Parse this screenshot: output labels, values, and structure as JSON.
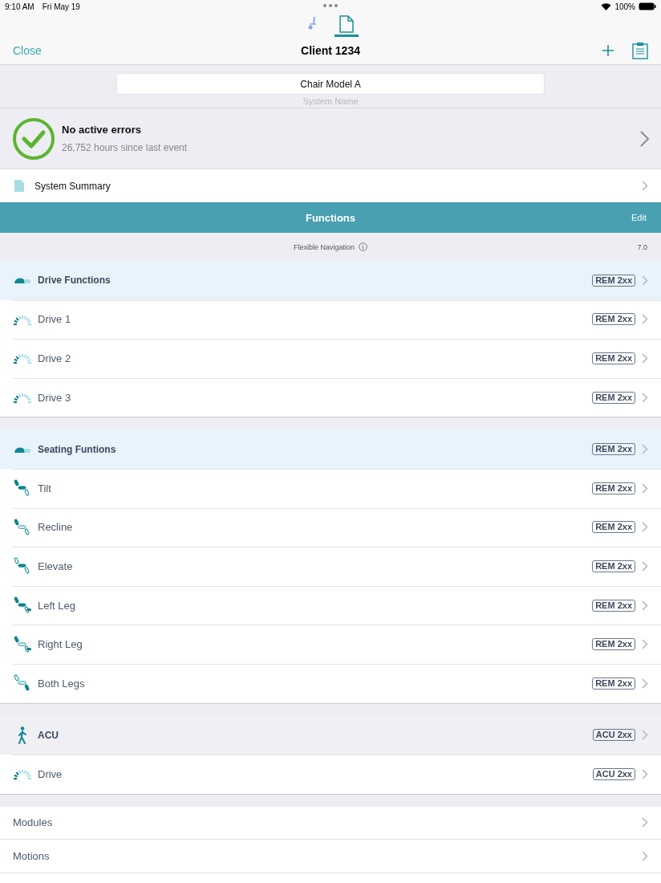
{
  "status_bar": {
    "time": "9:10 AM",
    "date": "Fri May 19",
    "battery": "100%"
  },
  "tabs": [
    {
      "kind": "chair",
      "selected": false
    },
    {
      "kind": "document",
      "selected": true
    }
  ],
  "nav": {
    "close": "Close",
    "title": "Client 1234"
  },
  "system": {
    "value": "Chair Model A",
    "placeholder": "System Name"
  },
  "errors": {
    "title": "No active errors",
    "subtitle": "26,752 hours since last event"
  },
  "summary": {
    "label": "System Summary"
  },
  "functions_bar": {
    "title": "Functions",
    "edit": "Edit"
  },
  "flexible_navigation": {
    "label": "Flexible Navigation",
    "version": "7.0"
  },
  "groups": [
    {
      "label": "Drive Functions",
      "badge": "REM 2xx",
      "kind": "toggle",
      "items": [
        {
          "label": "Drive 1",
          "badge": "REM 2xx",
          "kind": "gauge"
        },
        {
          "label": "Drive 2",
          "badge": "REM 2xx",
          "kind": "gauge"
        },
        {
          "label": "Drive 3",
          "badge": "REM 2xx",
          "kind": "gauge"
        }
      ]
    },
    {
      "label": "Seating Funtions",
      "badge": "REM 2xx",
      "kind": "toggle",
      "items": [
        {
          "label": "Tilt",
          "badge": "REM 2xx",
          "kind": "tilt"
        },
        {
          "label": "Recline",
          "badge": "REM 2xx",
          "kind": "recline"
        },
        {
          "label": "Elevate",
          "badge": "REM 2xx",
          "kind": "elevate"
        },
        {
          "label": "Left Leg",
          "badge": "REM 2xx",
          "kind": "leftleg"
        },
        {
          "label": "Right Leg",
          "badge": "REM 2xx",
          "kind": "rightleg"
        },
        {
          "label": "Both Legs",
          "badge": "REM 2xx",
          "kind": "bothlegs"
        }
      ]
    },
    {
      "label": "ACU",
      "badge": "ACU 2xx",
      "kind": "walker",
      "items": [
        {
          "label": "Drive",
          "badge": "ACU 2xx",
          "kind": "gauge"
        }
      ]
    }
  ],
  "menu": [
    {
      "label": "Modules"
    },
    {
      "label": "Motions"
    }
  ]
}
